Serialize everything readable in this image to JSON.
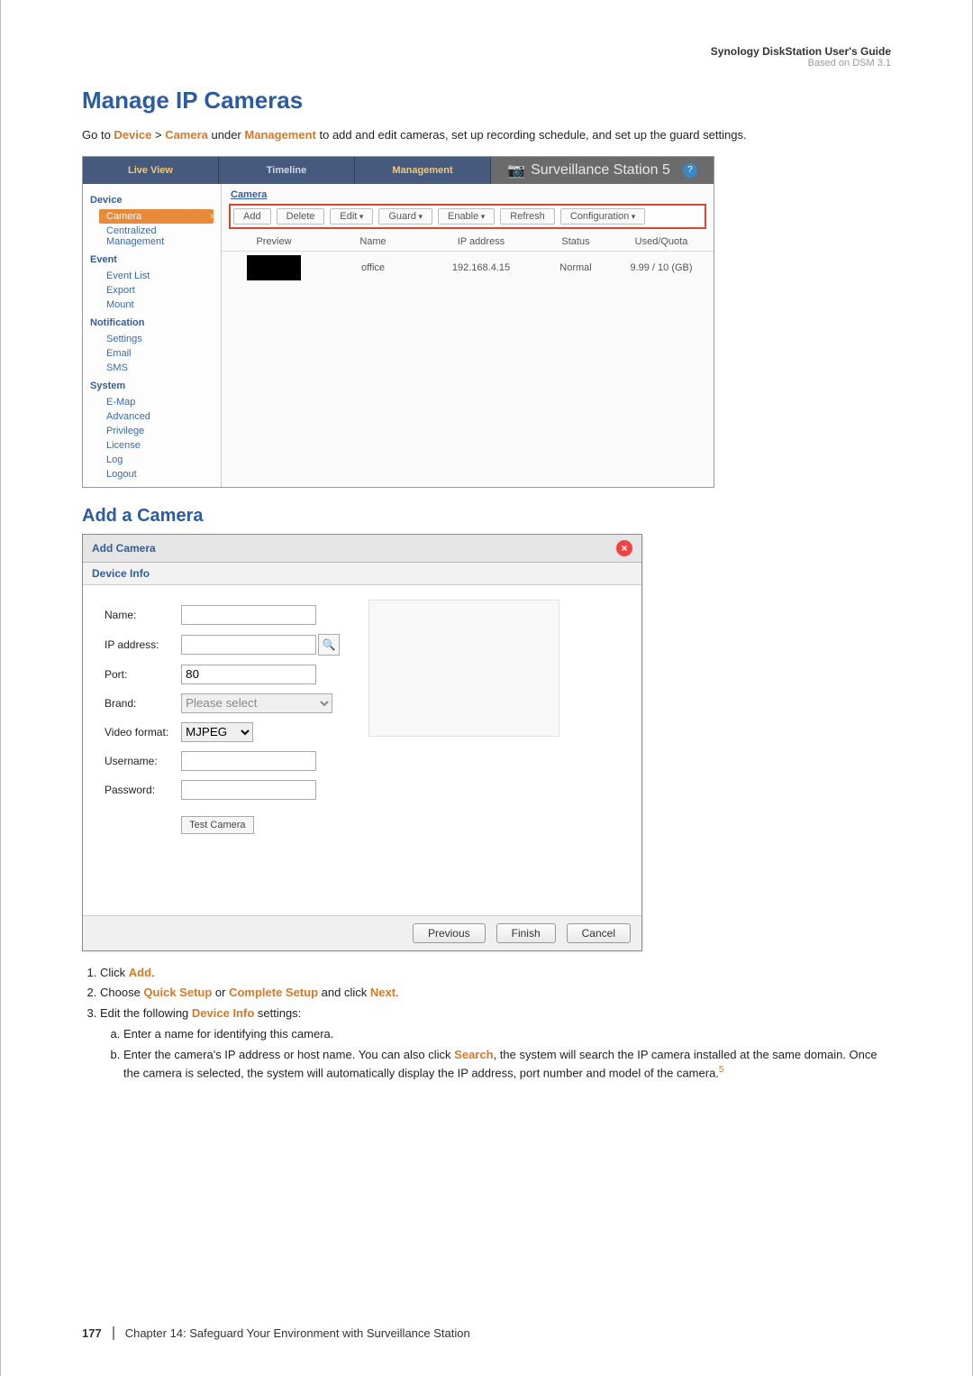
{
  "header": {
    "guide": "Synology DiskStation User's Guide",
    "dsm": "Based on DSM 3.1"
  },
  "h1": "Manage IP Cameras",
  "intro": {
    "pre": "Go to ",
    "device": "Device",
    "gt": " > ",
    "camera": "Camera",
    "under": " under ",
    "management": "Management",
    "post": " to add and edit cameras, set up recording schedule, and set up the guard settings."
  },
  "ss": {
    "tabs": {
      "live": "Live View",
      "timeline": "Timeline",
      "management": "Management"
    },
    "title": "Surveillance Station 5",
    "side": {
      "device": "Device",
      "camera": "Camera",
      "centralized": "Centralized Management",
      "event": "Event",
      "eventList": "Event List",
      "export": "Export",
      "mount": "Mount",
      "notification": "Notification",
      "settings": "Settings",
      "email": "Email",
      "sms": "SMS",
      "system": "System",
      "emap": "E-Map",
      "advanced": "Advanced",
      "privilege": "Privilege",
      "license": "License",
      "log": "Log",
      "logout": "Logout"
    },
    "mainTitle": "Camera",
    "toolbar": {
      "add": "Add",
      "delete": "Delete",
      "edit": "Edit",
      "guard": "Guard",
      "enable": "Enable",
      "refresh": "Refresh",
      "configuration": "Configuration"
    },
    "cols": {
      "preview": "Preview",
      "name": "Name",
      "ip": "IP address",
      "status": "Status",
      "used": "Used/Quota"
    },
    "row": {
      "name": "office",
      "ip": "192.168.4.15",
      "status": "Normal",
      "used": "9.99 / 10 (GB)"
    }
  },
  "h2": "Add a Camera",
  "dlg": {
    "title": "Add Camera",
    "sub": "Device Info",
    "labels": {
      "name": "Name:",
      "ip": "IP address:",
      "port": "Port:",
      "brand": "Brand:",
      "vf": "Video format:",
      "user": "Username:",
      "pass": "Password:"
    },
    "values": {
      "port": "80",
      "brand": "Please select",
      "vf": "MJPEG"
    },
    "test": "Test Camera",
    "buttons": {
      "prev": "Previous",
      "finish": "Finish",
      "cancel": "Cancel"
    }
  },
  "steps": {
    "s1a": "Click ",
    "s1b": "Add",
    "s1c": ".",
    "s2a": "Choose ",
    "s2b": "Quick Setup",
    "s2c": " or ",
    "s2d": "Complete Setup",
    "s2e": " and click ",
    "s2f": "Next",
    "s2g": ".",
    "s3a": "Edit the following ",
    "s3b": "Device Info",
    "s3c": " settings:",
    "suba": "Enter a name for identifying this camera.",
    "subb1": "Enter the camera's IP address or host name. You can also click ",
    "subb2": "Search",
    "subb3": ", the system will search the IP camera installed at the same domain. Once the camera is selected, the system will automatically display the IP address, port number and model of the camera.",
    "fn": "5"
  },
  "footer": {
    "page": "177",
    "chapter": "Chapter 14: Safeguard Your Environment with Surveillance Station"
  }
}
